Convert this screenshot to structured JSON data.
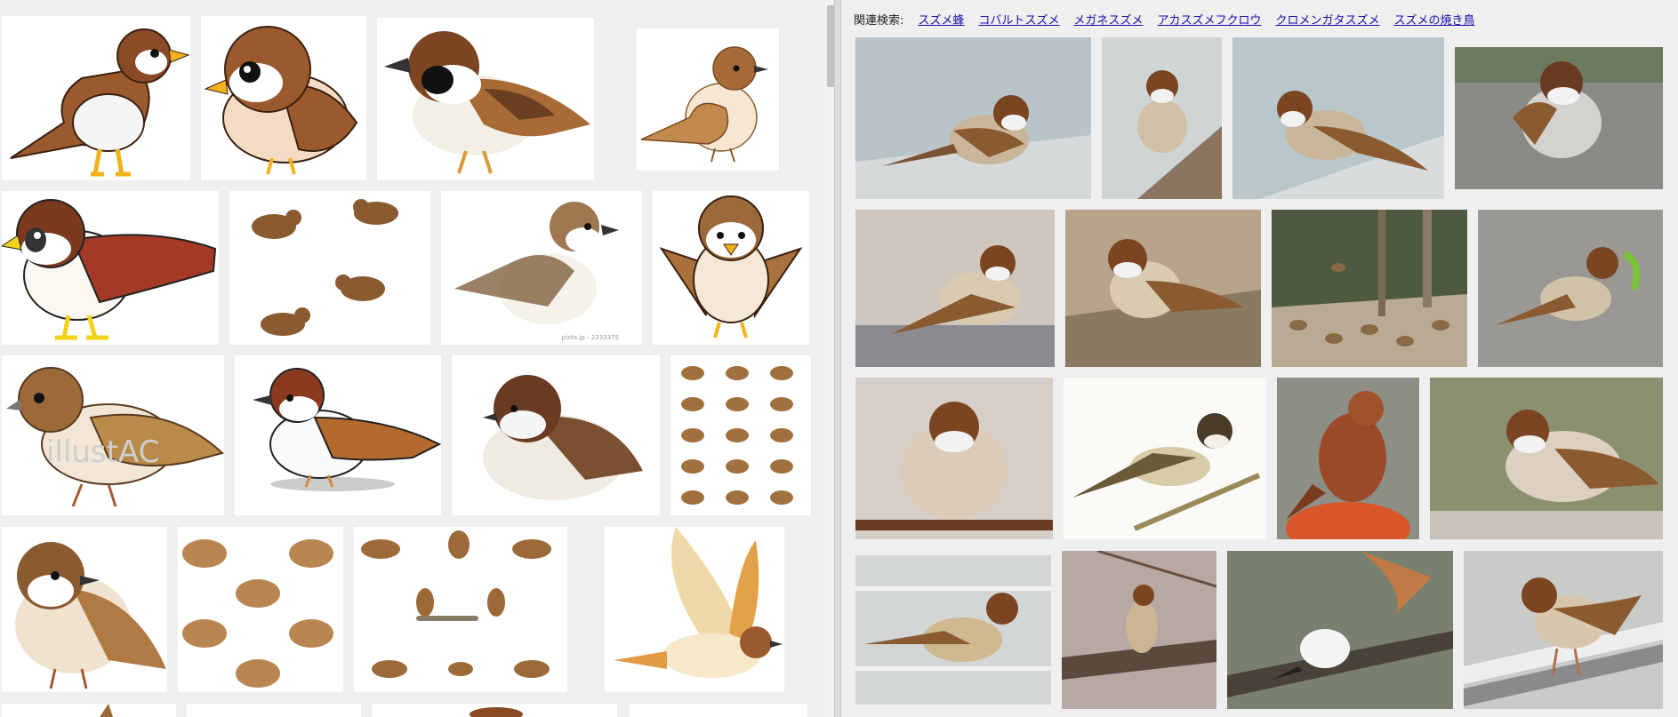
{
  "related": {
    "label": "関連検索:",
    "links": [
      "スズメ蜂",
      "コバルトスズメ",
      "メガネスズメ",
      "アカスズメフクロウ",
      "クロメンガタスズメ",
      "スズメの焼き鳥"
    ]
  },
  "watermarks": {
    "illust_ac": "illustAC",
    "pixta_id": "pixta.jp - 2333375"
  },
  "colors": {
    "background": "#efefef",
    "link": "#1a0dab",
    "bird_brown": "#9b5a2d",
    "bird_cap": "#7b3a1e",
    "bird_belly": "#f7f2e8",
    "beak_yellow": "#f2b21a"
  },
  "left_grid": {
    "tiles": [
      {
        "icon": "sparrow-illustration-icon"
      },
      {
        "icon": "sparrow-illustration-icon"
      },
      {
        "icon": "sparrow-illustration-icon"
      },
      {
        "icon": "sparrow-illustration-icon"
      },
      {
        "icon": "sparrow-illustration-icon"
      },
      {
        "icon": "sparrow-group-illustration-icon"
      },
      {
        "icon": "sparrow-sketch-illustration-icon"
      },
      {
        "icon": "sparrow-front-illustration-icon"
      },
      {
        "icon": "sparrow-illustration-icon"
      },
      {
        "icon": "sparrow-illustration-icon"
      },
      {
        "icon": "sparrow-fluffy-illustration-icon"
      },
      {
        "icon": "sparrow-pattern-illustration-icon"
      },
      {
        "icon": "sparrow-illustration-icon"
      },
      {
        "icon": "sparrow-pattern-illustration-icon"
      },
      {
        "icon": "sparrow-group-illustration-icon"
      },
      {
        "icon": "sparrow-flying-illustration-icon"
      }
    ]
  },
  "right_grid": {
    "photos": [
      {
        "icon": "sparrow-photo-icon"
      },
      {
        "icon": "sparrow-photo-icon"
      },
      {
        "icon": "sparrow-photo-icon"
      },
      {
        "icon": "sparrow-photo-icon"
      },
      {
        "icon": "sparrow-photo-icon"
      },
      {
        "icon": "sparrow-photo-icon"
      },
      {
        "icon": "sparrow-flock-photo-icon"
      },
      {
        "icon": "sparrow-photo-icon"
      },
      {
        "icon": "sparrow-photo-icon"
      },
      {
        "icon": "sparrow-painting-icon"
      },
      {
        "icon": "brown-bird-photo-icon"
      },
      {
        "icon": "sparrow-photo-icon"
      },
      {
        "icon": "sparrow-photo-icon"
      },
      {
        "icon": "sparrow-photo-icon"
      },
      {
        "icon": "white-bird-photo-icon"
      },
      {
        "icon": "sparrow-photo-icon"
      }
    ]
  }
}
